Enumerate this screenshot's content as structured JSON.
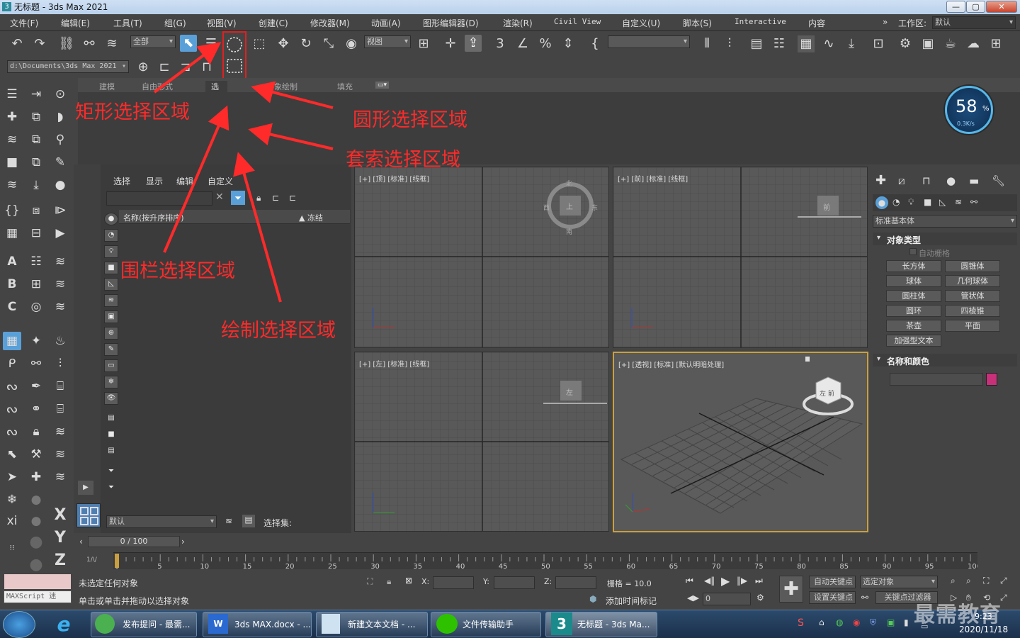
{
  "window": {
    "title": "无标题 - 3ds Max 2021",
    "icon": "3",
    "min": "—",
    "max": "▢",
    "close": "✕"
  },
  "menu": [
    "文件(F)",
    "编辑(E)",
    "工具(T)",
    "组(G)",
    "视图(V)",
    "创建(C)",
    "修改器(M)",
    "动画(A)",
    "图形编辑器(D)",
    "渲染(R)",
    "Civil View",
    "自定义(U)",
    "脚本(S)",
    "Interactive",
    "内容"
  ],
  "workspace": {
    "chevron": "»",
    "label": "工作区:",
    "value": "默认"
  },
  "toolbar": {
    "filter": "全部",
    "ref_coord": "视图",
    "path": "d:\\Documents\\3ds Max 2021",
    "named_sel": ""
  },
  "region_flyout": {
    "icons": [
      "circle-dashed",
      "rect-dashed",
      "circle-dashed",
      "fence-dashed",
      "lasso-dashed",
      "paint-brush"
    ]
  },
  "ribbon": {
    "tabs": [
      "建模",
      "自由形式",
      "选",
      "对象绘制",
      "填充"
    ]
  },
  "net_meter": {
    "value": "58",
    "unit": "%",
    "speed": "0.3K/s"
  },
  "scene_explorer": {
    "tabs": [
      "选择",
      "显示",
      "编辑",
      "自定义"
    ],
    "col_name": "名称(按升序排序)",
    "col_freeze": "▲ 冻结",
    "layer": "默认",
    "selset_label": "选择集:"
  },
  "viewports": [
    {
      "label": "[+] [顶] [标准] [线框]",
      "cube": "上",
      "n": "北",
      "s": "南",
      "w": "西",
      "e": "东"
    },
    {
      "label": "[+] [前] [标准] [线框]",
      "cube": "前"
    },
    {
      "label": "[+] [左] [标准] [线框]",
      "cube": "左"
    },
    {
      "label": "[+] [透视] [标准] [默认明暗处理]",
      "cube": "左 前"
    }
  ],
  "command_panel": {
    "category": "标准基本体",
    "section_object_type": "对象类型",
    "autogrid": "自动栅格",
    "buttons": [
      "长方体",
      "圆锥体",
      "球体",
      "几何球体",
      "圆柱体",
      "管状体",
      "圆环",
      "四棱锥",
      "茶壶",
      "平面",
      "加强型文本"
    ],
    "section_name_color": "名称和颜色",
    "color": "#c8307a"
  },
  "annotations": {
    "rect": "矩形选择区域",
    "circle": "圆形选择区域",
    "lasso": "套索选择区域",
    "fence": "围栏选择区域",
    "paint": "绘制选择区域",
    "color": "#ff2a2a"
  },
  "timeline": {
    "frame": "0 / 100",
    "ticks": [
      "0",
      "5",
      "10",
      "15",
      "20",
      "25",
      "30",
      "35",
      "40",
      "45",
      "50",
      "55",
      "60",
      "65",
      "70",
      "75",
      "80",
      "85",
      "90",
      "95",
      "100"
    ],
    "key_mode": "1/\\/"
  },
  "status": {
    "maxscript": "MAXScript 迷",
    "line1": "未选定任何对象",
    "line2": "单击或单击并拖动以选择对象",
    "x_label": "X:",
    "y_label": "Y:",
    "z_label": "Z:",
    "grid": "栅格 = 10.0",
    "add_time_tag": "添加时间标记",
    "auto_key": "自动关键点",
    "set_key": "设置关键点",
    "sel_obj": "选定对象",
    "key_filter": "关键点过滤器",
    "frame_field": "0"
  },
  "taskbar": {
    "items": [
      "发布提问 - 最需...",
      "3ds MAX.docx - ...",
      "新建文本文档 - ...",
      "文件传输助手",
      "无标题 - 3ds Ma..."
    ],
    "time": "9:23",
    "date": "2020/11/18",
    "watermark": "最需教育"
  }
}
